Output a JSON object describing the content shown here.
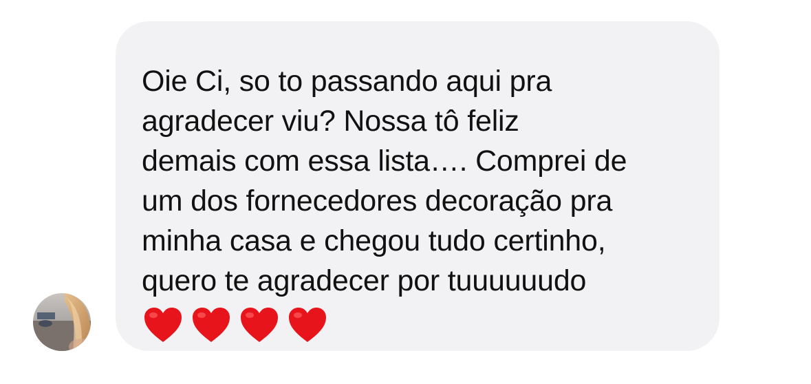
{
  "message": {
    "text": "Oie Ci, so to passando aqui pra\nagradecer viu? Nossa tô feliz\ndemais com essa lista…. Comprei de\num dos fornecedores decoração pra\nminha casa e chegou tudo certinho,\nquero te agradecer por tuuuuuudo",
    "emoji": [
      "❤️",
      "❤️",
      "❤️",
      "❤️"
    ]
  },
  "colors": {
    "bubble_bg": "#f2f2f4",
    "text": "#111111",
    "heart": "#e8141b"
  },
  "icons": {
    "avatar": "sender-avatar-photo",
    "emoji": "red-heart-icon"
  }
}
